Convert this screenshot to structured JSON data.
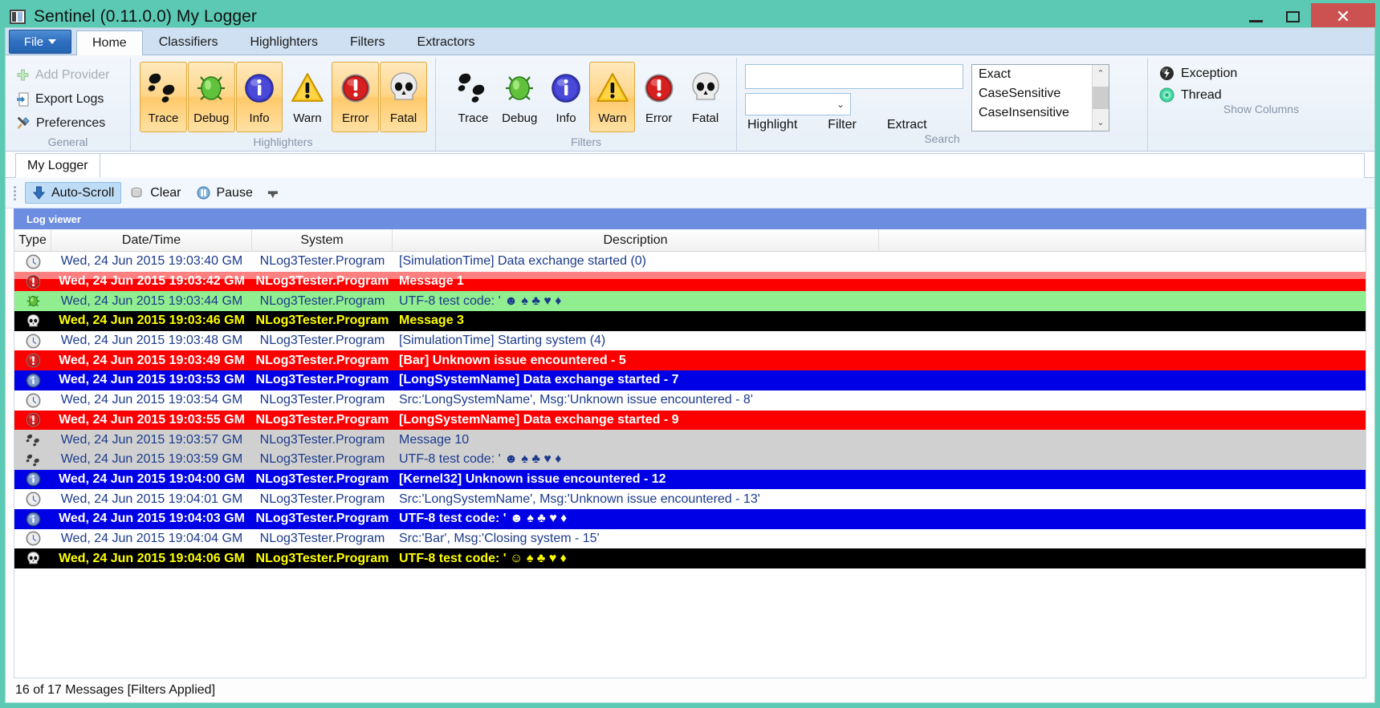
{
  "window": {
    "title": "Sentinel (0.11.0.0) My Logger",
    "icon": "app-icon",
    "minimize": "–",
    "maximize": "□",
    "close": "✕",
    "titlebar_color": "#5bc9b4",
    "close_color": "#cc5252"
  },
  "ribbon": {
    "file_button": "File",
    "tabs": [
      {
        "label": "Home",
        "active": true
      },
      {
        "label": "Classifiers",
        "active": false
      },
      {
        "label": "Highlighters",
        "active": false
      },
      {
        "label": "Filters",
        "active": false
      },
      {
        "label": "Extractors",
        "active": false
      }
    ],
    "groups": [
      {
        "name": "general",
        "label": "General",
        "commands": [
          {
            "label": "Add Provider",
            "icon": "plus-icon",
            "disabled": true
          },
          {
            "label": "Export Logs",
            "icon": "export-icon",
            "disabled": false
          },
          {
            "label": "Preferences",
            "icon": "tools-icon",
            "disabled": false
          }
        ]
      },
      {
        "name": "highlighters",
        "label": "Highlighters",
        "buttons": [
          {
            "label": "Trace",
            "icon": "footprints-icon",
            "active": true
          },
          {
            "label": "Debug",
            "icon": "bug-icon",
            "active": true
          },
          {
            "label": "Info",
            "icon": "info-icon",
            "active": true
          },
          {
            "label": "Warn",
            "icon": "warning-icon",
            "active": false
          },
          {
            "label": "Error",
            "icon": "error-icon",
            "active": true
          },
          {
            "label": "Fatal",
            "icon": "skull-icon",
            "active": true
          }
        ]
      },
      {
        "name": "filters",
        "label": "Filters",
        "buttons": [
          {
            "label": "Trace",
            "icon": "footprints-icon",
            "active": false
          },
          {
            "label": "Debug",
            "icon": "bug-icon",
            "active": false
          },
          {
            "label": "Info",
            "icon": "info-icon",
            "active": false
          },
          {
            "label": "Warn",
            "icon": "warning-icon",
            "active": true
          },
          {
            "label": "Error",
            "icon": "error-icon",
            "active": false
          },
          {
            "label": "Fatal",
            "icon": "skull-icon",
            "active": false
          }
        ]
      },
      {
        "name": "search",
        "label": "Search",
        "search_value": "",
        "search_placeholder": "",
        "combo_value": "",
        "actions": [
          "Highlight",
          "Filter",
          "Extract"
        ],
        "match_options": [
          "Exact",
          "CaseSensitive",
          "CaseInsensitive"
        ]
      },
      {
        "name": "show-columns",
        "label": "Show Columns",
        "items": [
          {
            "label": "Exception",
            "icon": "exception-icon"
          },
          {
            "label": "Thread",
            "icon": "thread-icon"
          }
        ]
      }
    ]
  },
  "document_tabs": [
    {
      "label": "My Logger",
      "active": true
    }
  ],
  "command_strip": [
    {
      "label": "Auto-Scroll",
      "icon": "down-arrow-icon",
      "active": true
    },
    {
      "label": "Clear",
      "icon": "clear-icon",
      "active": false
    },
    {
      "label": "Pause",
      "icon": "pause-icon",
      "active": false
    }
  ],
  "log_viewer": {
    "title": "Log viewer",
    "columns": [
      "Type",
      "Date/Time",
      "System",
      "Description",
      ""
    ],
    "rows": [
      {
        "type": "clock-icon",
        "date": "Wed, 24 Jun 2015 19:03:40 GM",
        "system": "NLog3Tester.Program",
        "description": "[SimulationTime] Data exchange started (0)",
        "bg": "#ffffff",
        "fg": "#1b3a8c",
        "stripe": ""
      },
      {
        "type": "error-icon",
        "date": "Wed, 24 Jun 2015 19:03:42 GM",
        "system": "NLog3Tester.Program",
        "description": "Message 1",
        "bg": "#fc0000",
        "fg": "#ffffff",
        "stripe": "#ff8080"
      },
      {
        "type": "bug-icon",
        "date": "Wed, 24 Jun 2015 19:03:44 GM",
        "system": "NLog3Tester.Program",
        "description": "UTF-8 test code: ' ☻ ♠ ♣ ♥ ♦",
        "bg": "#90ee90",
        "fg": "#1b3a8c",
        "stripe": ""
      },
      {
        "type": "skull-icon",
        "date": "Wed, 24 Jun 2015 19:03:46 GM",
        "system": "NLog3Tester.Program",
        "description": "Message 3",
        "bg": "#000000",
        "fg": "#ffff00",
        "stripe": ""
      },
      {
        "type": "clock-icon",
        "date": "Wed, 24 Jun 2015 19:03:48 GM",
        "system": "NLog3Tester.Program",
        "description": "[SimulationTime] Starting system (4)",
        "bg": "#ffffff",
        "fg": "#1b3a8c",
        "stripe": ""
      },
      {
        "type": "error-icon",
        "date": "Wed, 24 Jun 2015 19:03:49 GM",
        "system": "NLog3Tester.Program",
        "description": "[Bar] Unknown issue encountered - 5",
        "bg": "#fc0000",
        "fg": "#ffffff",
        "stripe": ""
      },
      {
        "type": "info-icon",
        "date": "Wed, 24 Jun 2015 19:03:53 GM",
        "system": "NLog3Tester.Program",
        "description": "[LongSystemName] Data exchange started - 7",
        "bg": "#0000e6",
        "fg": "#ffffff",
        "stripe": ""
      },
      {
        "type": "clock-icon",
        "date": "Wed, 24 Jun 2015 19:03:54 GM",
        "system": "NLog3Tester.Program",
        "description": "Src:'LongSystemName', Msg:'Unknown issue encountered - 8'",
        "bg": "#ffffff",
        "fg": "#1b3a8c",
        "stripe": ""
      },
      {
        "type": "error-icon",
        "date": "Wed, 24 Jun 2015 19:03:55 GM",
        "system": "NLog3Tester.Program",
        "description": "[LongSystemName] Data exchange started - 9",
        "bg": "#fc0000",
        "fg": "#ffffff",
        "stripe": ""
      },
      {
        "type": "footprints-icon",
        "date": "Wed, 24 Jun 2015 19:03:57 GM",
        "system": "NLog3Tester.Program",
        "description": "Message 10",
        "bg": "#d0d0d0",
        "fg": "#1b3a8c",
        "stripe": ""
      },
      {
        "type": "footprints-icon",
        "date": "Wed, 24 Jun 2015 19:03:59 GM",
        "system": "NLog3Tester.Program",
        "description": "UTF-8 test code: ' ☻ ♠ ♣ ♥ ♦",
        "bg": "#d0d0d0",
        "fg": "#1b3a8c",
        "stripe": ""
      },
      {
        "type": "info-icon",
        "date": "Wed, 24 Jun 2015 19:04:00 GM",
        "system": "NLog3Tester.Program",
        "description": "[Kernel32] Unknown issue encountered - 12",
        "bg": "#0000e6",
        "fg": "#ffffff",
        "stripe": ""
      },
      {
        "type": "clock-icon",
        "date": "Wed, 24 Jun 2015 19:04:01 GM",
        "system": "NLog3Tester.Program",
        "description": "Src:'LongSystemName', Msg:'Unknown issue encountered - 13'",
        "bg": "#ffffff",
        "fg": "#1b3a8c",
        "stripe": ""
      },
      {
        "type": "info-icon",
        "date": "Wed, 24 Jun 2015 19:04:03 GM",
        "system": "NLog3Tester.Program",
        "description": "UTF-8 test code: ' ☻ ♠ ♣ ♥ ♦",
        "bg": "#0000e6",
        "fg": "#ffffff",
        "stripe": ""
      },
      {
        "type": "clock-icon",
        "date": "Wed, 24 Jun 2015 19:04:04 GM",
        "system": "NLog3Tester.Program",
        "description": "Src:'Bar', Msg:'Closing system - 15'",
        "bg": "#ffffff",
        "fg": "#1b3a8c",
        "stripe": ""
      },
      {
        "type": "skull-icon",
        "date": "Wed, 24 Jun 2015 19:04:06 GM",
        "system": "NLog3Tester.Program",
        "description": "UTF-8 test code: ' ☺ ♠ ♣ ♥ ♦",
        "bg": "#000000",
        "fg": "#ffff00",
        "stripe": ""
      }
    ]
  },
  "status_bar": {
    "text": "16 of 17 Messages [Filters Applied]"
  }
}
